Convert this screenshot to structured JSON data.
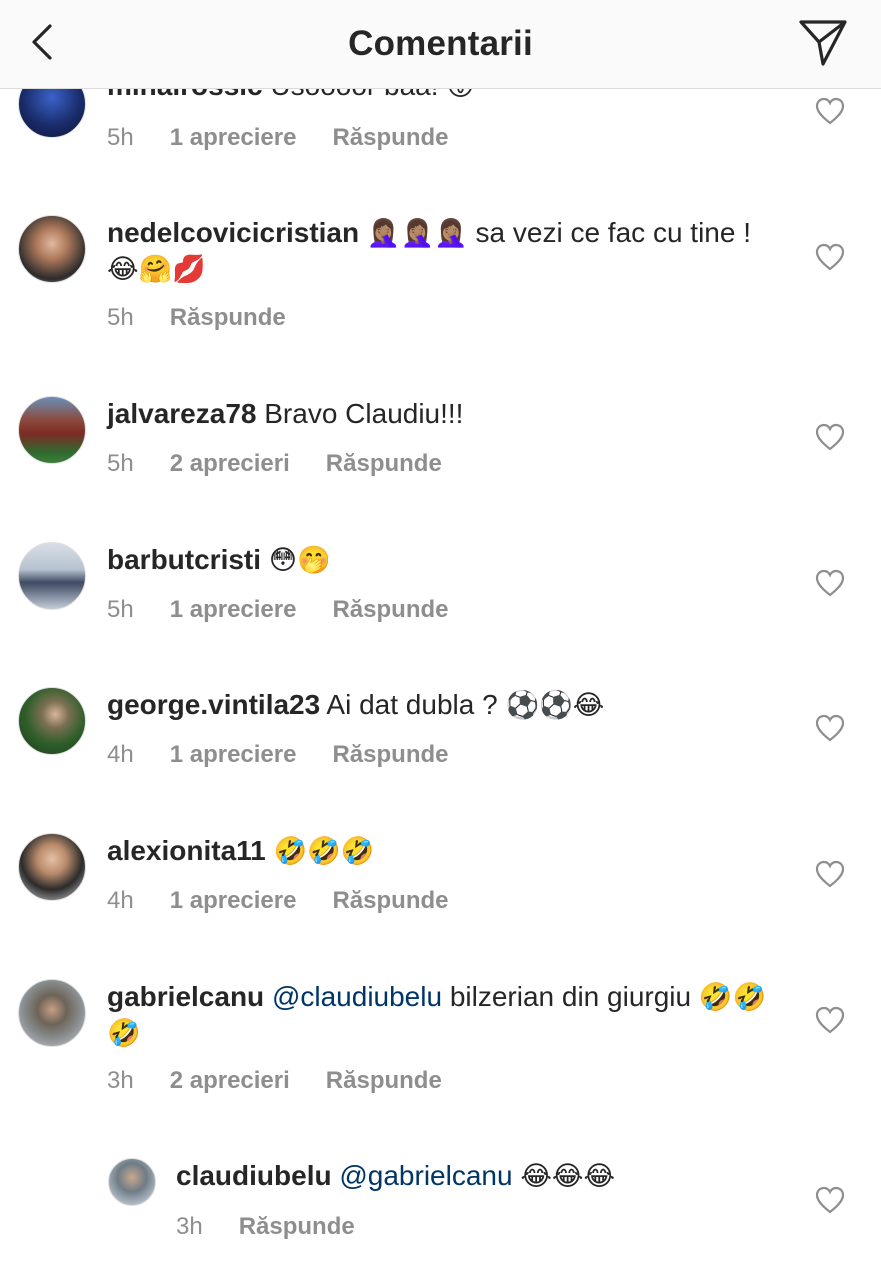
{
  "header": {
    "title": "Comentarii"
  },
  "comments": [
    {
      "user": "mihairossic",
      "text": "Usoooor baa!",
      "emoji": "😛",
      "time": "5h",
      "likes": "1 apreciere",
      "reply": "Răspunde"
    },
    {
      "user": "nedelcovicicristian",
      "text_prefix": "🤦🏽‍♀️🤦🏽‍♀️🤦🏽‍♀️",
      "text": "sa vezi ce fac cu tine !",
      "emoji": "😂🤗💋",
      "time": "5h",
      "reply": "Răspunde"
    },
    {
      "user": "jalvareza78",
      "text": "Bravo Claudiu!!!",
      "time": "5h",
      "likes": "2 aprecieri",
      "reply": "Răspunde"
    },
    {
      "user": "barbutcristi",
      "emoji": "😳🤭",
      "time": "5h",
      "likes": "1 apreciere",
      "reply": "Răspunde"
    },
    {
      "user": "george.vintila23",
      "text": "Ai dat dubla ?",
      "emoji": "⚽⚽😂",
      "time": "4h",
      "likes": "1 apreciere",
      "reply": "Răspunde"
    },
    {
      "user": "alexionita11",
      "emoji": "🤣🤣🤣",
      "time": "4h",
      "likes": "1 apreciere",
      "reply": "Răspunde"
    },
    {
      "user": "gabrielcanu",
      "mention": "@claudiubelu",
      "text": "bilzerian din giurgiu",
      "emoji": "🤣🤣🤣",
      "time": "3h",
      "likes": "2 aprecieri",
      "reply": "Răspunde"
    },
    {
      "user": "claudiubelu",
      "mention": "@gabrielcanu",
      "emoji": "😂😂😂",
      "time": "3h",
      "reply": "Răspunde"
    }
  ],
  "colors": {
    "text": "#262626",
    "muted": "#8e8e8e",
    "mention": "#003569",
    "divider": "#dbdbdb"
  },
  "icons": {
    "back": "chevron-left-icon",
    "send": "paper-plane-icon",
    "like": "heart-outline-icon"
  }
}
